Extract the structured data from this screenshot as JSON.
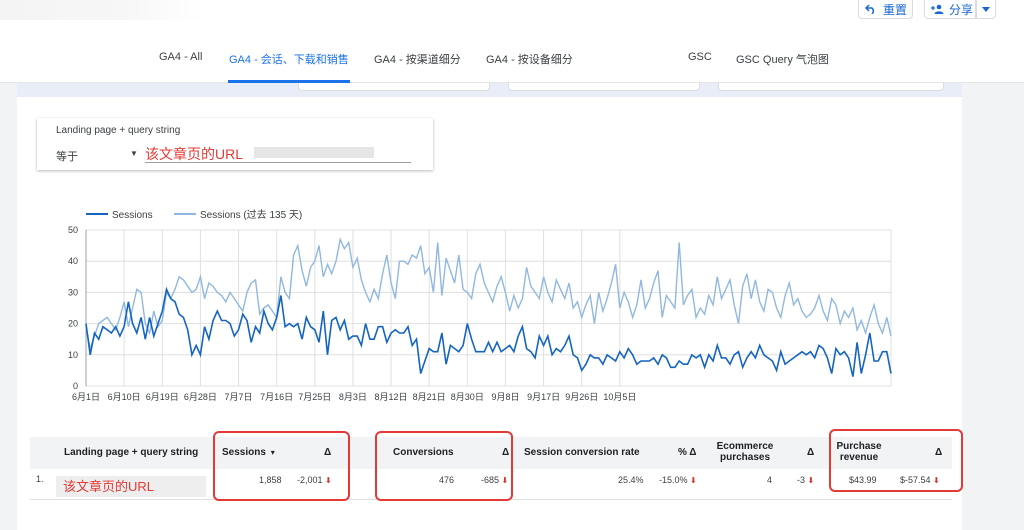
{
  "toolbar": {
    "reset_label": "重置",
    "share_label": "分享"
  },
  "tabs": [
    {
      "label": "GA4 - All"
    },
    {
      "label": "GA4 - 会话、下载和销售"
    },
    {
      "label": "GA4 - 按渠道细分"
    },
    {
      "label": "GA4 - 按设备细分"
    },
    {
      "label": "GSC"
    },
    {
      "label": "GSC Query 气泡图"
    }
  ],
  "filter": {
    "label": "Landing page + query string",
    "operator": "等于",
    "value": "该文章页的URL"
  },
  "chart_data": {
    "type": "line",
    "x_tick_labels": [
      "6月1日",
      "6月10日",
      "6月19日",
      "6月28日",
      "7月7日",
      "7月16日",
      "7月25日",
      "8月3日",
      "8月12日",
      "8月21日",
      "8月30日",
      "9月8日",
      "9月17日",
      "9月26日",
      "10月5日"
    ],
    "x_tick_index": [
      0,
      9,
      18,
      27,
      36,
      45,
      54,
      63,
      72,
      81,
      90,
      99,
      108,
      117,
      126
    ],
    "ylim": [
      0,
      50
    ],
    "y_ticks": [
      0,
      10,
      20,
      30,
      40,
      50
    ],
    "legend_position": "top-left",
    "grid": true,
    "series": [
      {
        "name": "Sessions",
        "color": "#1565c0",
        "values": [
          20,
          11,
          17,
          15,
          19,
          18,
          17,
          19,
          16,
          19,
          27,
          20,
          17,
          22,
          15,
          22,
          16,
          20,
          24,
          31,
          28,
          27,
          23,
          22,
          18,
          10,
          13,
          10,
          19,
          15,
          21,
          24,
          21,
          21,
          20,
          16,
          18,
          23,
          21,
          14,
          19,
          15,
          24,
          20,
          18,
          22,
          29,
          19,
          20,
          19,
          20,
          15,
          22,
          19,
          18,
          14,
          24,
          10,
          21,
          22,
          18,
          21,
          15,
          16,
          16,
          13,
          20,
          15,
          15,
          19,
          19,
          14,
          17,
          18,
          17,
          17,
          19,
          13,
          15,
          4,
          8,
          12,
          11,
          11,
          17,
          7,
          13,
          12,
          10,
          13,
          20,
          15,
          11,
          11,
          11,
          14,
          11,
          14,
          11,
          12,
          13,
          11,
          16,
          19,
          12,
          11,
          9,
          16,
          13,
          16,
          10,
          12,
          11,
          13,
          16,
          10,
          9,
          5,
          7,
          10,
          9,
          9,
          7,
          10,
          9,
          8,
          11,
          9,
          12,
          10,
          7,
          8,
          8,
          8,
          9,
          7,
          10,
          9,
          6,
          6,
          8,
          7,
          7,
          10,
          9,
          10,
          6,
          10,
          8,
          13,
          9,
          9,
          7,
          10,
          11,
          6,
          9,
          11,
          9,
          13,
          10,
          9,
          8,
          5,
          11,
          7,
          8,
          9,
          10,
          11,
          10,
          11,
          9,
          13,
          12,
          9,
          4,
          12,
          10,
          11,
          9,
          3,
          14,
          4,
          10,
          17,
          8,
          8,
          11,
          11,
          4
        ],
        "values_note": ""
      },
      {
        "name": "Sessions (过去 135 天)",
        "color": "#90b8e0",
        "values": []
      }
    ],
    "series_values": {
      "sessions": [
        20,
        10,
        17,
        15,
        19,
        18,
        17,
        19,
        16,
        19,
        27,
        20,
        17,
        22,
        15,
        22,
        16,
        20,
        24,
        31,
        28,
        27,
        23,
        22,
        18,
        10,
        13,
        10,
        19,
        15,
        21,
        24,
        21,
        21,
        20,
        16,
        18,
        23,
        21,
        14,
        19,
        17,
        24,
        20,
        18,
        22,
        29,
        19,
        20,
        19,
        20,
        15,
        22,
        19,
        18,
        14,
        24,
        10,
        21,
        22,
        18,
        21,
        15,
        16,
        16,
        13,
        20,
        15,
        15,
        19,
        19,
        14,
        17,
        18,
        17,
        17,
        19,
        13,
        15,
        4,
        8,
        12,
        11,
        11,
        17,
        7,
        13,
        12,
        11,
        13,
        20,
        15,
        11,
        11,
        11,
        14,
        11,
        14,
        11,
        12,
        13,
        11,
        16,
        19,
        12,
        11,
        9,
        16,
        13,
        16,
        10,
        12,
        11,
        13,
        16,
        10,
        9,
        5,
        7,
        10,
        9,
        9,
        7,
        10,
        9,
        8,
        11,
        9,
        12,
        10,
        7,
        8,
        8,
        8,
        9,
        7,
        10,
        9,
        6,
        6,
        8,
        7,
        7,
        10,
        9,
        10,
        6,
        10,
        8,
        13,
        9,
        9,
        7,
        10,
        11,
        6,
        9,
        11,
        9,
        13,
        10,
        9,
        8,
        5,
        11,
        7,
        8,
        9,
        10,
        11,
        10,
        11,
        9,
        13,
        12,
        9,
        4,
        12,
        10,
        11,
        9,
        3,
        14,
        4,
        10,
        17,
        8,
        8,
        11,
        11,
        4
      ],
      "sessions_previous": [
        19,
        12,
        16,
        20,
        21,
        22,
        20,
        18,
        22,
        27,
        19,
        25,
        31,
        30,
        20,
        17,
        24,
        19,
        21,
        30,
        28,
        31,
        35,
        34,
        32,
        30,
        31,
        35,
        28,
        33,
        32,
        30,
        29,
        27,
        30,
        28,
        26,
        24,
        30,
        33,
        34,
        23,
        25,
        26,
        24,
        22,
        35,
        30,
        28,
        42,
        45,
        37,
        32,
        38,
        40,
        45,
        35,
        39,
        36,
        40,
        47,
        44,
        46,
        38,
        41,
        34,
        30,
        27,
        31,
        28,
        36,
        42,
        33,
        28,
        40,
        40,
        39,
        42,
        41,
        45,
        36,
        38,
        30,
        46,
        29,
        41,
        37,
        33,
        42,
        31,
        30,
        28,
        36,
        39,
        33,
        30,
        27,
        32,
        35,
        30,
        24,
        29,
        25,
        28,
        38,
        32,
        30,
        28,
        35,
        30,
        27,
        34,
        31,
        28,
        33,
        25,
        27,
        22,
        26,
        29,
        20,
        30,
        24,
        28,
        33,
        39,
        25,
        30,
        27,
        22,
        26,
        34,
        25,
        28,
        33,
        37,
        22,
        29,
        27,
        25,
        46,
        26,
        29,
        31,
        22,
        25,
        23,
        29,
        26,
        35,
        28,
        31,
        34,
        26,
        20,
        32,
        36,
        28,
        34,
        27,
        24,
        31,
        30,
        25,
        22,
        29,
        33,
        26,
        28,
        24,
        22,
        23,
        25,
        29,
        24,
        21,
        28,
        26,
        20,
        24,
        22,
        25,
        18,
        21,
        17,
        22,
        26,
        20,
        17,
        22,
        16
      ]
    }
  },
  "table": {
    "headers": {
      "landing": "Landing page + query string",
      "sessions": "Sessions",
      "sort_icon": "▾",
      "delta": "Δ",
      "conversions": "Conversions",
      "scr": "Session conversion rate",
      "pct_delta": "% Δ",
      "ecom_1": "Ecommerce",
      "ecom_2": "purchases",
      "rev_1": "Purchase",
      "rev_2": "revenue"
    },
    "row": {
      "index": "1.",
      "landing": "该文章页的URL",
      "sessions": "1,858",
      "sessions_delta": "-2,001",
      "conversions": "476",
      "conversions_delta": "-685",
      "scr": "25.4%",
      "scr_delta": "-15.0%",
      "ecom": "4",
      "ecom_delta": "-3",
      "revenue": "$43.99",
      "revenue_delta": "$-57.54",
      "down_arrow": "⬇"
    }
  },
  "colors": {
    "accent": "#1a73e8",
    "highlight": "#e53935",
    "series_current": "#1565c0",
    "series_previous": "#90b8e0"
  }
}
